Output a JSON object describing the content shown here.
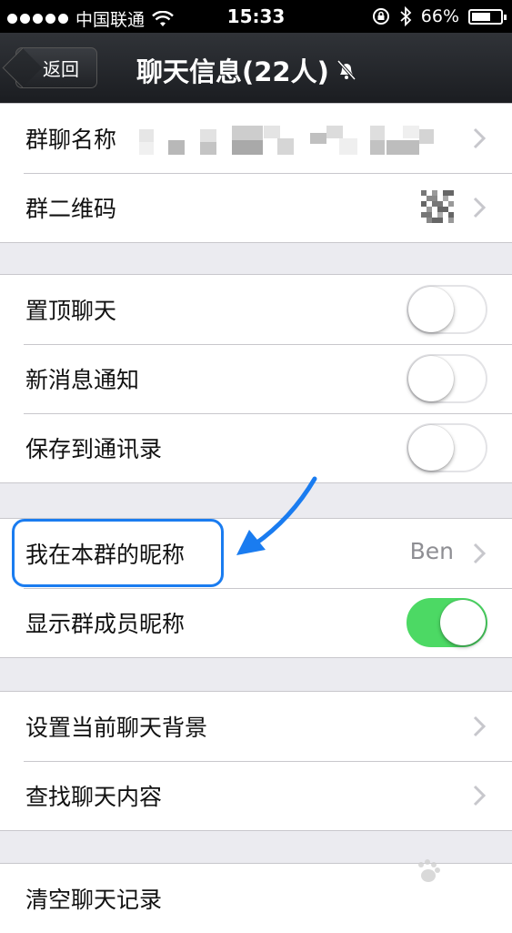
{
  "status_bar": {
    "carrier": "中国联通",
    "time": "15:33",
    "battery": "66%",
    "battery_level": 0.66
  },
  "nav": {
    "back_label": "返回",
    "title": "聊天信息(22人)"
  },
  "group1": {
    "group_name_label": "群聊名称",
    "qr_label": "群二维码"
  },
  "group2": {
    "pin_label": "置顶聊天",
    "pin_on": false,
    "notify_label": "新消息通知",
    "notify_on": false,
    "save_label": "保存到通讯录",
    "save_on": false
  },
  "group3": {
    "nickname_label": "我在本群的昵称",
    "nickname_value": "Ben",
    "show_nick_label": "显示群成员昵称",
    "show_nick_on": true
  },
  "group4": {
    "background_label": "设置当前聊天背景",
    "search_label": "查找聊天内容"
  },
  "group5": {
    "clear_label": "清空聊天记录"
  },
  "colors": {
    "accent_highlight": "#1a7cf0",
    "toggle_on": "#4cd964",
    "background": "#ebebf0"
  }
}
